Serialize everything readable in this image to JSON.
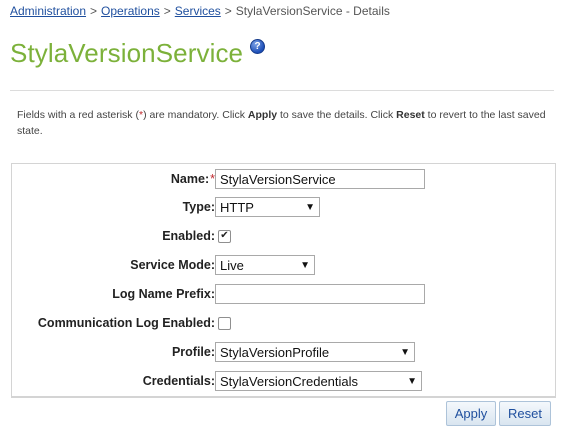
{
  "breadcrumb": {
    "items": [
      "Administration",
      "Operations",
      "Services"
    ],
    "separator": ">",
    "current": "StylaVersionService - Details"
  },
  "page": {
    "title": "StylaVersionService",
    "help_icon_glyph": "?"
  },
  "info": {
    "part1": "Fields with a red asterisk (",
    "asterisk": "*",
    "part2": ") are mandatory. Click ",
    "apply_word": "Apply",
    "part3": " to save the details. Click ",
    "reset_word": "Reset",
    "part4": " to revert to the last saved state."
  },
  "form": {
    "name_label": "Name:",
    "required_mark": "*",
    "name_value": "StylaVersionService",
    "type_label": "Type:",
    "type_value": "HTTP",
    "enabled_label": "Enabled:",
    "enabled_checked": true,
    "enabled_mark": "✔",
    "service_mode_label": "Service Mode:",
    "service_mode_value": "Live",
    "log_prefix_label": "Log Name Prefix:",
    "log_prefix_value": "",
    "comm_log_label": "Communication Log Enabled:",
    "comm_log_checked": false,
    "profile_label": "Profile:",
    "profile_value": "StylaVersionProfile",
    "credentials_label": "Credentials:",
    "credentials_value": "StylaVersionCredentials",
    "dropdown_arrow": "▼"
  },
  "buttons": {
    "apply": "Apply",
    "reset": "Reset"
  },
  "colors": {
    "title_green": "#7cb13a",
    "link_blue": "#1f4f9e",
    "required_red": "#c0282d"
  }
}
